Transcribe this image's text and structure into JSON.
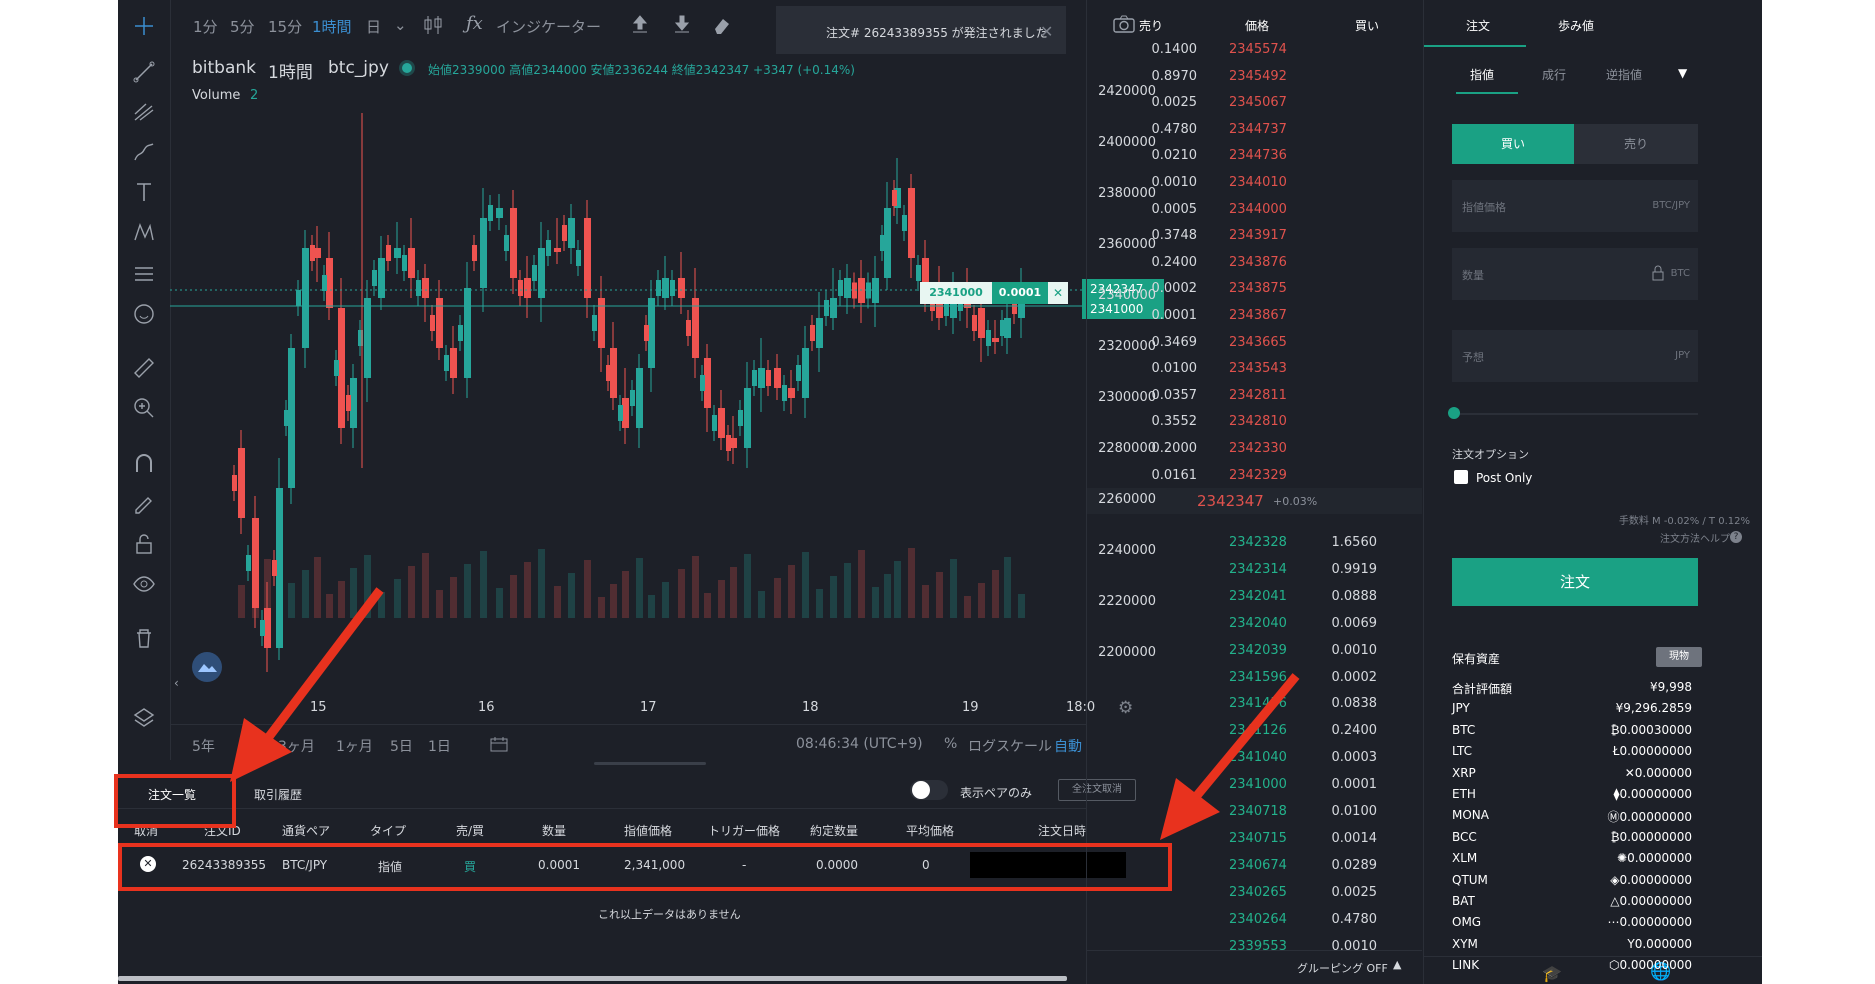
{
  "toolbar": {
    "timeframes": [
      "1分",
      "5分",
      "15分",
      "1時間",
      "日"
    ],
    "active_timeframe": "1時間",
    "indicator_label": "インジケーター"
  },
  "notification": "注文# 26243389355 が発注されました",
  "chart": {
    "exchange": "bitbank",
    "interval": "1時間",
    "pair": "btc_jpy",
    "ohlc_text": "始値2339000 高値2344000 安値2336244 終値2342347 +3347 (+0.14%)",
    "volume_label": "Volume",
    "volume_value": "2",
    "price_axis": [
      "2420000",
      "2400000",
      "2380000",
      "2360000",
      "2340000",
      "2320000",
      "2300000",
      "2280000",
      "2260000",
      "2240000",
      "2220000",
      "2200000"
    ],
    "last_price_tag": "2342347",
    "order_price_tag": "2341000",
    "order_line_price": "2341000",
    "order_line_qty": "0.0001",
    "time_axis": [
      "15",
      "16",
      "17",
      "18",
      "19",
      "18:0"
    ],
    "ranges": [
      "5年",
      "3ヶ月",
      "1ヶ月",
      "5日",
      "1日"
    ],
    "clock": "08:46:34 (UTC+9)",
    "pct": "%",
    "log_label": "ログスケール",
    "auto_label": "自動"
  },
  "bottom": {
    "tabs": [
      "注文一覧",
      "取引履歴"
    ],
    "toggle_label": "表示ペアのみ",
    "cancel_all": "全注文取消",
    "columns": [
      "取消",
      "注文ID",
      "通貨ペア",
      "タイプ",
      "売/買",
      "数量",
      "指値価格",
      "トリガー価格",
      "約定数量",
      "平均価格",
      "注文日時"
    ],
    "row": {
      "id": "26243389355",
      "pair": "BTC/JPY",
      "type": "指値",
      "side": "買",
      "qty": "0.0001",
      "price": "2,341,000",
      "trigger": "-",
      "filled": "0.0000",
      "avg": "0"
    },
    "no_more": "これ以上データはありません"
  },
  "orderbook": {
    "headers": [
      "売り",
      "価格",
      "買い"
    ],
    "asks": [
      {
        "amt": "0.1400",
        "price": "2345574"
      },
      {
        "amt": "0.8970",
        "price": "2345492"
      },
      {
        "amt": "0.0025",
        "price": "2345067"
      },
      {
        "amt": "0.4780",
        "price": "2344737"
      },
      {
        "amt": "0.0210",
        "price": "2344736"
      },
      {
        "amt": "0.0010",
        "price": "2344010"
      },
      {
        "amt": "0.0005",
        "price": "2344000"
      },
      {
        "amt": "0.3748",
        "price": "2343917"
      },
      {
        "amt": "0.2400",
        "price": "2343876"
      },
      {
        "amt": "0.0002",
        "price": "2343875"
      },
      {
        "amt": "0.0001",
        "price": "2343867"
      },
      {
        "amt": "0.3469",
        "price": "2343665"
      },
      {
        "amt": "0.0100",
        "price": "2343543"
      },
      {
        "amt": "0.0357",
        "price": "2342811"
      },
      {
        "amt": "0.3552",
        "price": "2342810"
      },
      {
        "amt": "0.2000",
        "price": "2342330"
      },
      {
        "amt": "0.0161",
        "price": "2342329"
      }
    ],
    "last_price": "2342347",
    "last_change": "+0.03%",
    "bids": [
      {
        "price": "2342328",
        "amt": "1.6560"
      },
      {
        "price": "2342314",
        "amt": "0.9919"
      },
      {
        "price": "2342041",
        "amt": "0.0888"
      },
      {
        "price": "2342040",
        "amt": "0.0069"
      },
      {
        "price": "2342039",
        "amt": "0.0010"
      },
      {
        "price": "2341596",
        "amt": "0.0002"
      },
      {
        "price": "2341456",
        "amt": "0.0838"
      },
      {
        "price": "2341126",
        "amt": "0.2400"
      },
      {
        "price": "2341040",
        "amt": "0.0003"
      },
      {
        "price": "2341000",
        "amt": "0.0001"
      },
      {
        "price": "2340718",
        "amt": "0.0100"
      },
      {
        "price": "2340715",
        "amt": "0.0014"
      },
      {
        "price": "2340674",
        "amt": "0.0289"
      },
      {
        "price": "2340265",
        "amt": "0.0025"
      },
      {
        "price": "2340264",
        "amt": "0.4780"
      },
      {
        "price": "2339553",
        "amt": "0.0010"
      }
    ],
    "grouping": "グルーピング OFF"
  },
  "order_form": {
    "tabs": [
      "注文",
      "歩み値"
    ],
    "types": [
      "指値",
      "成行",
      "逆指値"
    ],
    "buy": "買い",
    "sell": "売り",
    "price_placeholder": "指値価格",
    "price_unit": "BTC/JPY",
    "qty_placeholder": "数量",
    "qty_unit": "BTC",
    "est_placeholder": "予想",
    "est_unit": "JPY",
    "options_label": "注文オプション",
    "post_only": "Post Only",
    "fee": "手数料 M -0.02% / T 0.12%",
    "help": "注文方法ヘルプ",
    "submit": "注文"
  },
  "assets": {
    "title": "保有資産",
    "badge": "現物",
    "items": [
      {
        "name": "合計評価額",
        "value": "¥9,998"
      },
      {
        "name": "JPY",
        "value": "¥9,296.2859"
      },
      {
        "name": "BTC",
        "value": "₿0.00030000"
      },
      {
        "name": "LTC",
        "value": "Ł0.00000000"
      },
      {
        "name": "XRP",
        "value": "✕0.000000"
      },
      {
        "name": "ETH",
        "value": "⧫0.00000000"
      },
      {
        "name": "MONA",
        "value": "Ⓜ0.00000000"
      },
      {
        "name": "BCC",
        "value": "₿0.00000000"
      },
      {
        "name": "XLM",
        "value": "✺0.0000000"
      },
      {
        "name": "QTUM",
        "value": "◈0.00000000"
      },
      {
        "name": "BAT",
        "value": "△0.00000000"
      },
      {
        "name": "OMG",
        "value": "⋯0.00000000"
      },
      {
        "name": "XYM",
        "value": "Υ0.000000"
      },
      {
        "name": "LINK",
        "value": "⬡0.00000000"
      }
    ]
  },
  "colors": {
    "up": "#26a69a",
    "down": "#ef5350",
    "accent": "#1aa184",
    "highlight": "#e8321e"
  }
}
